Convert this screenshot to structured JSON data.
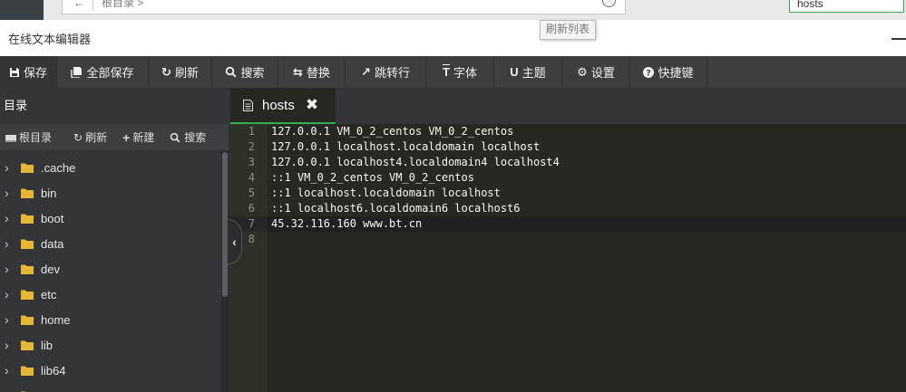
{
  "browser": {
    "back_glyph": "←",
    "breadcrumb": "根目录 >",
    "search_value": "hosts"
  },
  "tooltip": {
    "text": "刷新列表"
  },
  "window": {
    "title": "在线文本编辑器"
  },
  "toolbar": {
    "buttons": [
      {
        "label": "保存",
        "icon": "save-icon"
      },
      {
        "label": "全部保存",
        "icon": "save-all-icon"
      },
      {
        "label": "刷新",
        "icon": "refresh-icon"
      },
      {
        "label": "搜索",
        "icon": "search-icon"
      },
      {
        "label": "替换",
        "icon": "replace-icon"
      },
      {
        "label": "跳转行",
        "icon": "jump-icon"
      },
      {
        "label": "字体",
        "icon": "font-icon"
      },
      {
        "label": "主题",
        "icon": "theme-icon"
      },
      {
        "label": "设置",
        "icon": "gear-icon"
      },
      {
        "label": "快捷键",
        "icon": "help-icon"
      }
    ]
  },
  "sidebar": {
    "header": "目录",
    "actions": [
      {
        "label": "根目录",
        "icon": "drive-icon"
      },
      {
        "label": "刷新",
        "icon": "refresh-icon"
      },
      {
        "label": "新建",
        "icon": "plus-icon"
      },
      {
        "label": "搜索",
        "icon": "search-icon"
      }
    ],
    "tree": [
      ".cache",
      "bin",
      "boot",
      "data",
      "dev",
      "etc",
      "home",
      "lib",
      "lib64",
      ""
    ]
  },
  "tabs": [
    {
      "label": "hosts",
      "active": true
    }
  ],
  "editor": {
    "active_line": 7,
    "lines": [
      "127.0.0.1 VM_0_2_centos VM_0_2_centos",
      "127.0.0.1 localhost.localdomain localhost",
      "127.0.0.1 localhost4.localdomain4 localhost4",
      "::1 VM_0_2_centos VM_0_2_centos",
      "::1 localhost.localdomain localhost",
      "::1 localhost6.localdomain6 localhost6",
      "45.32.116.160 www.bt.cn",
      ""
    ]
  },
  "colors": {
    "accent": "#2bb24c",
    "folder": "#e8b731",
    "editor_bg": "#272822",
    "toolbar_bg": "#3c3f41"
  }
}
